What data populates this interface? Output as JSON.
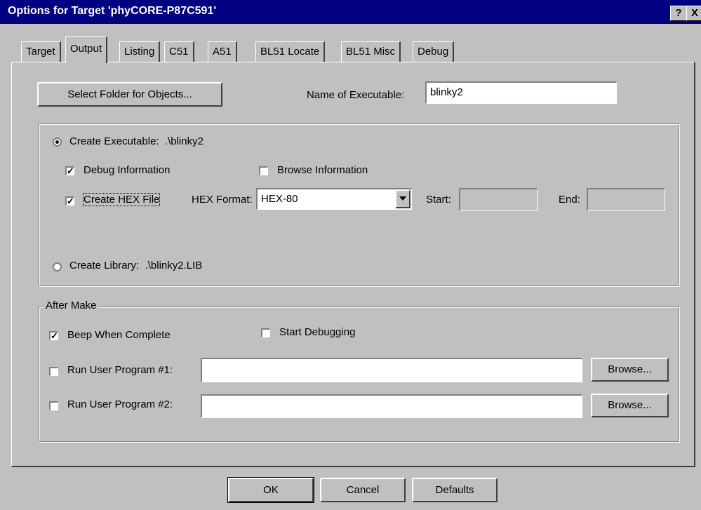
{
  "window": {
    "title": "Options for Target 'phyCORE-P87C591'",
    "help_btn": "?",
    "close_btn": "X"
  },
  "tabs": [
    {
      "label": "Target",
      "active": false
    },
    {
      "label": "Output",
      "active": true
    },
    {
      "label": "Listing",
      "active": false
    },
    {
      "label": "C51",
      "active": false
    },
    {
      "label": "A51",
      "active": false
    },
    {
      "label": "BL51 Locate",
      "active": false
    },
    {
      "label": "BL51 Misc",
      "active": false
    },
    {
      "label": "Debug",
      "active": false
    }
  ],
  "output": {
    "select_folder_label": "Select Folder for Objects...",
    "name_exec_label": "Name of Executable:",
    "name_exec_value": "blinky2",
    "create_exec_label": "Create Executable:",
    "create_exec_path": ".\\blinky2",
    "create_exec_selected": true,
    "debug_info_label": "Debug Information",
    "debug_info_checked": true,
    "browse_info_label": "Browse Information",
    "browse_info_checked": false,
    "create_hex_label": "Create HEX File",
    "create_hex_checked": true,
    "hex_format_label": "HEX Format:",
    "hex_format_value": "HEX-80",
    "start_label": "Start:",
    "start_value": "",
    "end_label": "End:",
    "end_value": "",
    "create_lib_label": "Create Library:",
    "create_lib_path": ".\\blinky2.LIB",
    "create_lib_selected": false
  },
  "after_make": {
    "group_label": "After Make",
    "beep_label": "Beep When Complete",
    "beep_checked": true,
    "start_debug_label": "Start Debugging",
    "start_debug_checked": false,
    "run1_label": "Run User Program #1:",
    "run1_checked": false,
    "run1_value": "",
    "run2_label": "Run User Program #2:",
    "run2_checked": false,
    "run2_value": "",
    "browse_label": "Browse..."
  },
  "footer": {
    "ok": "OK",
    "cancel": "Cancel",
    "defaults": "Defaults"
  }
}
